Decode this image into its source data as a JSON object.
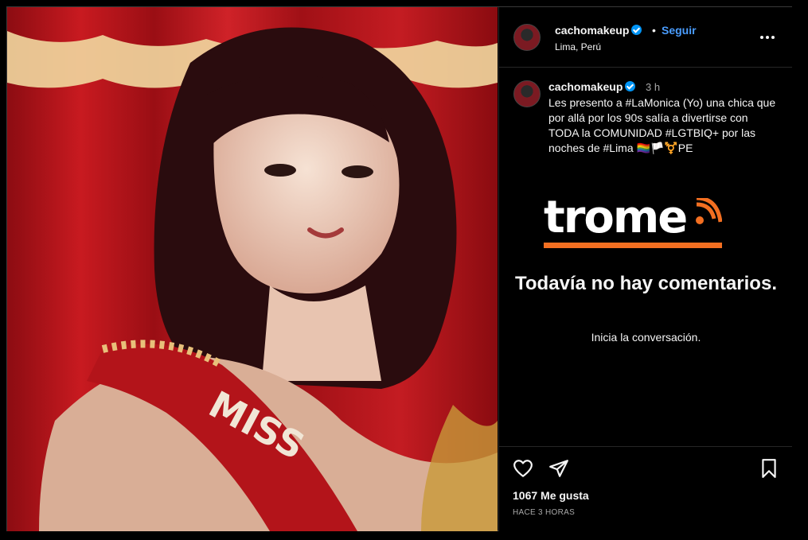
{
  "post": {
    "username": "cachomakeup",
    "follow_label": "Seguir",
    "separator": "•",
    "location": "Lima, Perú",
    "more_label": "•••",
    "time_ago": "3 h",
    "caption": "Les presento a #LaMonica (Yo) una chica que por allá por los 90s salía a divertirse con TODA la COMUNIDAD #LGTBIQ+ por las noches de #Lima 🏳️‍🌈🏳️⚧️PE",
    "photo_sash_text": "MISS"
  },
  "watermark": {
    "brand": "trome"
  },
  "comments": {
    "empty_title": "Todavía no hay comentarios.",
    "empty_subtitle": "Inicia la conversación."
  },
  "stats": {
    "likes": "1067 Me gusta",
    "time": "HACE 3 HORAS"
  },
  "icons": {
    "like": "heart-icon",
    "share": "paper-plane-icon",
    "save": "bookmark-icon"
  },
  "colors": {
    "accent": "#4a9dff",
    "verified": "#0095f6",
    "brand_orange": "#f36f21",
    "photo_red": "#b01418"
  }
}
